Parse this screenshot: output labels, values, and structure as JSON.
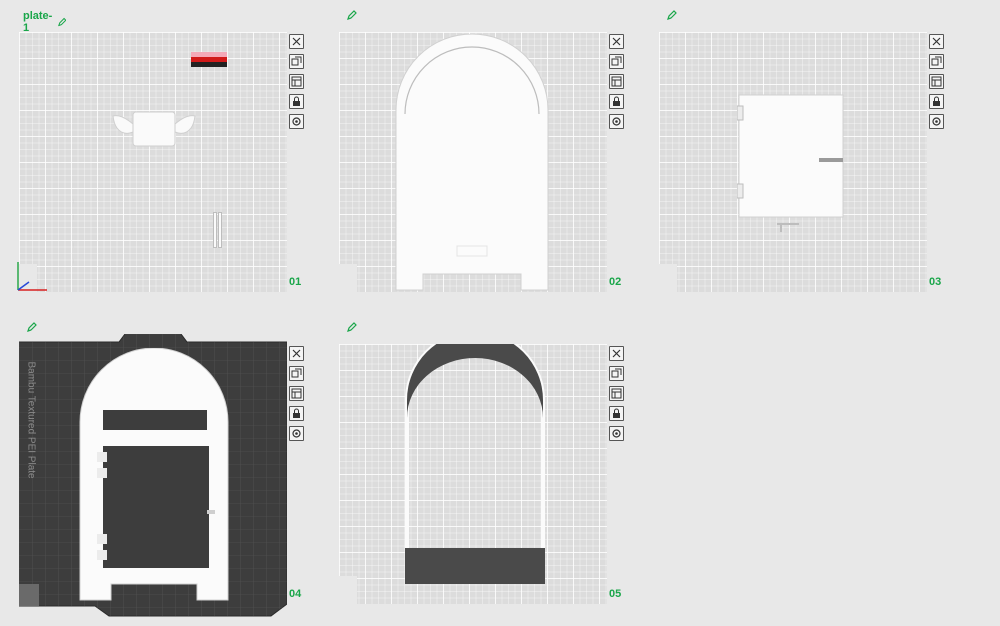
{
  "plates": [
    {
      "name": "plate-1",
      "index": "01"
    },
    {
      "name": "",
      "index": "02"
    },
    {
      "name": "",
      "index": "03"
    },
    {
      "name": "",
      "index": "04",
      "bed_label": "Bambu Textured PEI Plate"
    },
    {
      "name": "",
      "index": "05"
    }
  ],
  "toolbar_icons": [
    "close-icon",
    "arrange-icon",
    "orient-icon",
    "lock-icon",
    "settings-icon"
  ],
  "colors": {
    "accent": "#1aa64a",
    "bed": "#dcdcdc",
    "dark_bed": "#3d3d3d"
  }
}
